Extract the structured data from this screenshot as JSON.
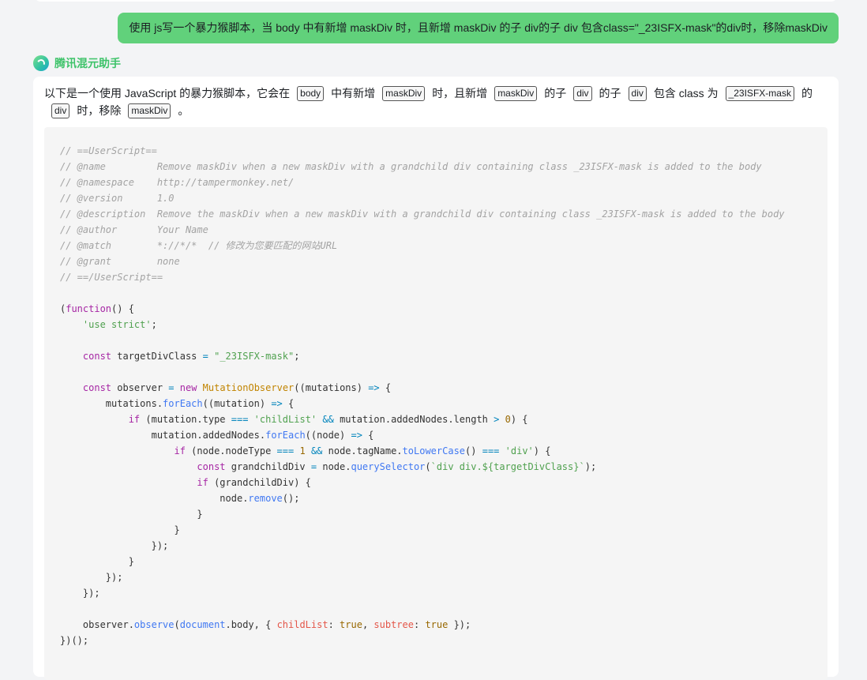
{
  "user_message": "使用 js写一个暴力猴脚本，当 body 中有新增 maskDiv 时，且新增 maskDiv 的子 div的子 div 包含class=\"_23ISFX-mask\"的div时，移除maskDiv",
  "assistant": {
    "name": "腾讯混元助手",
    "intro": {
      "t1": "以下是一个使用 JavaScript 的暴力猴脚本，它会在",
      "c1": "body",
      "t2": "中有新增",
      "c2": "maskDiv",
      "t3": "时，且新增",
      "c3": "maskDiv",
      "t4": "的子",
      "c4": "div",
      "t5": "的子",
      "c5": "div",
      "t6": "包含 class 为",
      "c6": "_23ISFX-mask",
      "t7": "的",
      "c7": "div",
      "t8": "时，移除",
      "c8": "maskDiv",
      "t9": "。"
    }
  },
  "code": {
    "h1": "// ==UserScript==",
    "h2": "// @name         Remove maskDiv when a new maskDiv with a grandchild div containing class _23ISFX-mask is added to the body",
    "h3": "// @namespace    http://tampermonkey.net/",
    "h4": "// @version      1.0",
    "h5": "// @description  Remove the maskDiv when a new maskDiv with a grandchild div containing class _23ISFX-mask is added to the body",
    "h6": "// @author       Your Name",
    "h7": "// @match        *://*/*  // 修改为您要匹配的网站URL",
    "h8": "// @grant        none",
    "h9": "// ==/UserScript==",
    "use_strict": "'use strict'",
    "target_class": "\"_23ISFX-mask\"",
    "child_list": "'childList'",
    "div_str": "'div'",
    "template": "`div div.${targetDivClass}`"
  }
}
